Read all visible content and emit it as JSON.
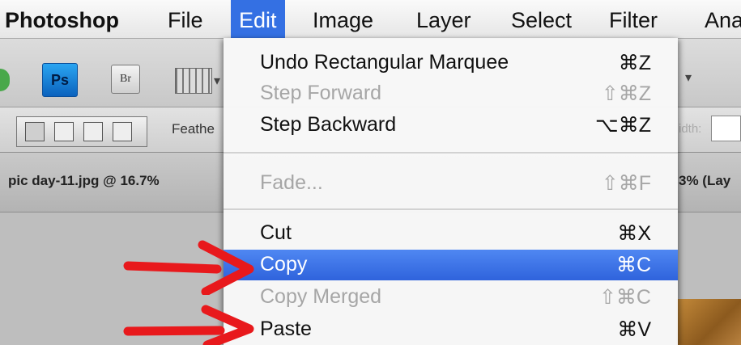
{
  "menubar": {
    "app": "Photoshop",
    "items": [
      "File",
      "Edit",
      "Image",
      "Layer",
      "Select",
      "Filter",
      "Ana"
    ]
  },
  "toolbar": {
    "ps_label": "Ps",
    "br_label": "Br"
  },
  "options_bar": {
    "feather_label": "Feathe",
    "width_label": "idth:"
  },
  "document_tabs": {
    "left": "pic day-11.jpg @ 16.7%",
    "right": "3% (Lay"
  },
  "edit_menu": {
    "items": [
      {
        "label": "Undo Rectangular Marquee",
        "shortcut": "⌘Z",
        "enabled": true
      },
      {
        "label": "Step Forward",
        "shortcut": "⇧⌘Z",
        "enabled": false
      },
      {
        "label": "Step Backward",
        "shortcut": "⌥⌘Z",
        "enabled": true
      },
      {
        "label": "Fade...",
        "shortcut": "⇧⌘F",
        "enabled": false
      },
      {
        "label": "Cut",
        "shortcut": "⌘X",
        "enabled": true
      },
      {
        "label": "Copy",
        "shortcut": "⌘C",
        "enabled": true,
        "highlighted": true
      },
      {
        "label": "Copy Merged",
        "shortcut": "⇧⌘C",
        "enabled": false
      },
      {
        "label": "Paste",
        "shortcut": "⌘V",
        "enabled": true
      }
    ]
  },
  "annotations": {
    "arrow_color": "#e8191c"
  },
  "colors": {
    "menu_highlight": "#3470e3",
    "ps_icon": "#1e88e5"
  }
}
